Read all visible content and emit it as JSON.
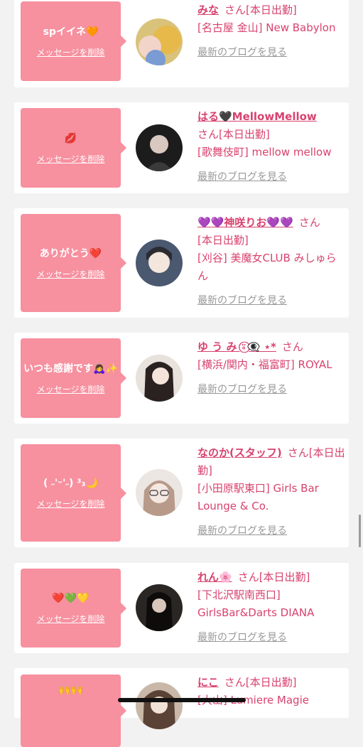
{
  "delete_label": "メッセージを削除",
  "blog_label": "最新のブログを見る",
  "accent_color": "#d8426e",
  "bubble_color": "#f7909f",
  "cards": [
    {
      "message": "spイイネ🧡",
      "name": "みな",
      "san": "さん",
      "status": "[本日出勤]",
      "shop": "[名古屋 金山] New Babylon"
    },
    {
      "message": "💋",
      "name": "はる🖤MellowMellow",
      "san": "さん",
      "status": "[本日出勤]",
      "shop": "[歌舞伎町] mellow mellow"
    },
    {
      "message": "ありがとう❤️",
      "name": "💜💜神咲りお💜💜",
      "san": "さん",
      "status": "[本日出勤]",
      "shop": "[刈谷] 美魔女CLUB みしゅらん"
    },
    {
      "message": "いつも感謝です🙇‍♀️✨",
      "name": "ゆ う み ⍤⃝👁‍🗨 ⋆*",
      "san": "さん",
      "status": "",
      "shop": "[横浜/関内・福富町] ROYAL"
    },
    {
      "message": "( ˶'ᵕ'˶) ³₃🌙",
      "name": "なのか(スタッフ)",
      "san": "さん",
      "status": "[本日出勤]",
      "shop": "[小田原駅東口] Girls Bar Lounge & Co."
    },
    {
      "message": "❤️💚💛",
      "name": "れん🌸",
      "san": "さん",
      "status": "[本日出勤]",
      "shop": "[下北沢駅南西口] GirlsBar&Darts DIANA"
    },
    {
      "message": "🙌🙌",
      "name": "にこ",
      "san": "さん",
      "status": "[本日出勤]",
      "shop": "[大山] Lumiere Magie"
    }
  ]
}
